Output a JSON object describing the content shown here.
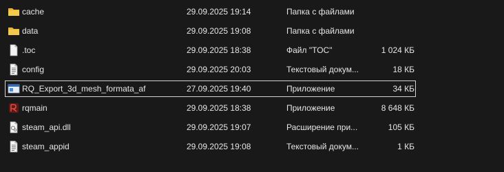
{
  "files": [
    {
      "name": "cache",
      "date": "29.09.2025 19:14",
      "type": "Папка с файлами",
      "size": "",
      "icon": "folder-icon"
    },
    {
      "name": "data",
      "date": "29.09.2025 19:08",
      "type": "Папка с файлами",
      "size": "",
      "icon": "folder-icon"
    },
    {
      "name": ".toc",
      "date": "29.09.2025 18:38",
      "type": "Файл \"TOC\"",
      "size": "1 024 КБ",
      "icon": "blank-file-icon"
    },
    {
      "name": "config",
      "date": "29.09.2025 20:03",
      "type": "Текстовый докум...",
      "size": "18 КБ",
      "icon": "text-file-icon"
    },
    {
      "name": "RQ_Export_3d_mesh_formata_af",
      "date": "27.09.2025 19:40",
      "type": "Приложение",
      "size": "34 КБ",
      "icon": "application-window-icon",
      "selected": true
    },
    {
      "name": "rqmain",
      "date": "29.09.2025 18:38",
      "type": "Приложение",
      "size": "8 648 КБ",
      "icon": "rqmain-app-icon"
    },
    {
      "name": "steam_api.dll",
      "date": "29.09.2025 19:07",
      "type": "Расширение при...",
      "size": "105 КБ",
      "icon": "dll-file-icon"
    },
    {
      "name": "steam_appid",
      "date": "29.09.2025 19:08",
      "type": "Текстовый докум...",
      "size": "1 КБ",
      "icon": "text-file-icon"
    }
  ],
  "colors": {
    "background": "#191919",
    "text": "#e6e6e6",
    "folder": "#f0c24a",
    "selection_border": "#d4d4d4"
  }
}
